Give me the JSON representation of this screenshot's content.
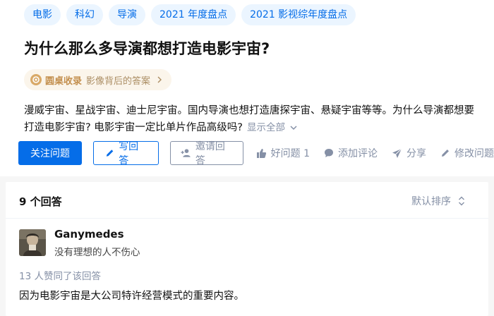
{
  "tags": [
    "电影",
    "科幻",
    "导演",
    "2021 年度盘点",
    "2021 影视综年度盘点"
  ],
  "question": {
    "title": "为什么那么多导演都想打造电影宇宙?",
    "collection": {
      "name": "圆桌收录",
      "subtitle": "影像背后的答案"
    },
    "description_line1": "漫威宇宙、星战宇宙、迪士尼宇宙。国内导演也想打造唐探宇宙、悬疑宇宙等等。为什么导演都想要",
    "description_line2": "打造电影宇宙? 电影宇宙一定比单片作品高级吗?",
    "show_all": "显示全部"
  },
  "actions": {
    "follow": "关注问题",
    "write": "写回答",
    "invite": "邀请回答",
    "good_question": "好问题 1",
    "comment": "添加评论",
    "share": "分享",
    "edit": "修改问题"
  },
  "answers": {
    "count_label": "9 个回答",
    "sort_label": "默认排序",
    "first": {
      "author": "Ganymedes",
      "motto": "没有理想的人不伤心",
      "votes": "13 人赞同了该回答",
      "content": "因为电影宇宙是大公司特许经营模式的重要内容。"
    }
  },
  "colors": {
    "primary": "#056de8",
    "muted": "#8590a6",
    "tag_bg": "#ebf5ff",
    "collect": "#c38f4e"
  }
}
